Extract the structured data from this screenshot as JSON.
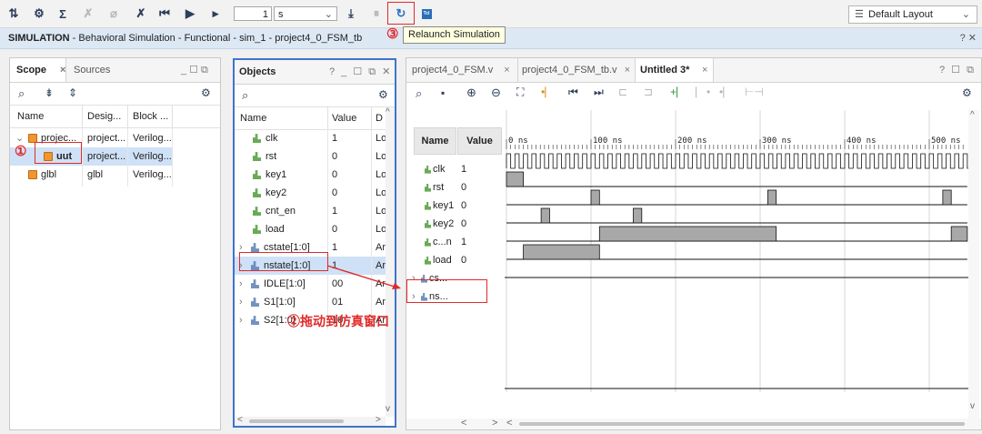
{
  "toolbar": {
    "run_value": "1",
    "run_unit": "s",
    "layout_label": "Default Layout"
  },
  "tooltip": "Relaunch Simulation",
  "sim_bar": {
    "mode": "SIMULATION",
    "subtitle": " - Behavioral Simulation - Functional - sim_1 - project4_0_FSM_tb",
    "help": "? ✕"
  },
  "scope_panel": {
    "tab_active": "Scope",
    "tab_other": "Sources",
    "columns": [
      "Name",
      "Desig...",
      "Block ..."
    ],
    "rows": [
      {
        "name": "projec...",
        "design": "project...",
        "block": "Verilog..."
      },
      {
        "name": "uut",
        "design": "project...",
        "block": "Verilog..."
      },
      {
        "name": "glbl",
        "design": "glbl",
        "block": "Verilog..."
      }
    ]
  },
  "objects_panel": {
    "title": "Objects",
    "controls": "? _ ☐ ⧉ ✕",
    "columns": [
      "Name",
      "Value",
      "D"
    ],
    "rows": [
      {
        "name": "clk",
        "value": "1",
        "d": "Lo"
      },
      {
        "name": "rst",
        "value": "0",
        "d": "Lo"
      },
      {
        "name": "key1",
        "value": "0",
        "d": "Lo"
      },
      {
        "name": "key2",
        "value": "0",
        "d": "Lo"
      },
      {
        "name": "cnt_en",
        "value": "1",
        "d": "Lo"
      },
      {
        "name": "load",
        "value": "0",
        "d": "Lo"
      },
      {
        "name": "cstate[1:0]",
        "value": "1",
        "d": "Ar"
      },
      {
        "name": "nstate[1:0]",
        "value": "1",
        "d": "Ar"
      },
      {
        "name": "IDLE[1:0]",
        "value": "00",
        "d": "Ar"
      },
      {
        "name": "S1[1:0]",
        "value": "01",
        "d": "Ar"
      },
      {
        "name": "S2[1:0]",
        "value": "10",
        "d": "Ar"
      }
    ]
  },
  "wave_panel": {
    "tabs": [
      "project4_0_FSM.v",
      "project4_0_FSM_tb.v",
      "Untitled 3*"
    ],
    "controls": "? ☐ ⧉",
    "name_header": "Name",
    "value_header": "Value",
    "signals": [
      {
        "name": "clk",
        "value": "1"
      },
      {
        "name": "rst",
        "value": "0"
      },
      {
        "name": "key1",
        "value": "0"
      },
      {
        "name": "key2",
        "value": "0"
      },
      {
        "name": "c...n",
        "value": "1"
      },
      {
        "name": "load",
        "value": "0"
      },
      {
        "name": "cs...",
        "value": ""
      },
      {
        "name": "ns...",
        "value": ""
      }
    ],
    "time_labels": [
      "0 ns",
      "100 ns",
      "200 ns",
      "300 ns",
      "400 ns",
      "500 ns"
    ]
  },
  "annotations": {
    "step1": "①",
    "step2": "②拖动到仿真窗口",
    "step3": "③"
  },
  "colors": {
    "accent_red": "#e02a2a",
    "objects_border": "#3f74c9",
    "wave_fill": "#a8a8a8"
  }
}
